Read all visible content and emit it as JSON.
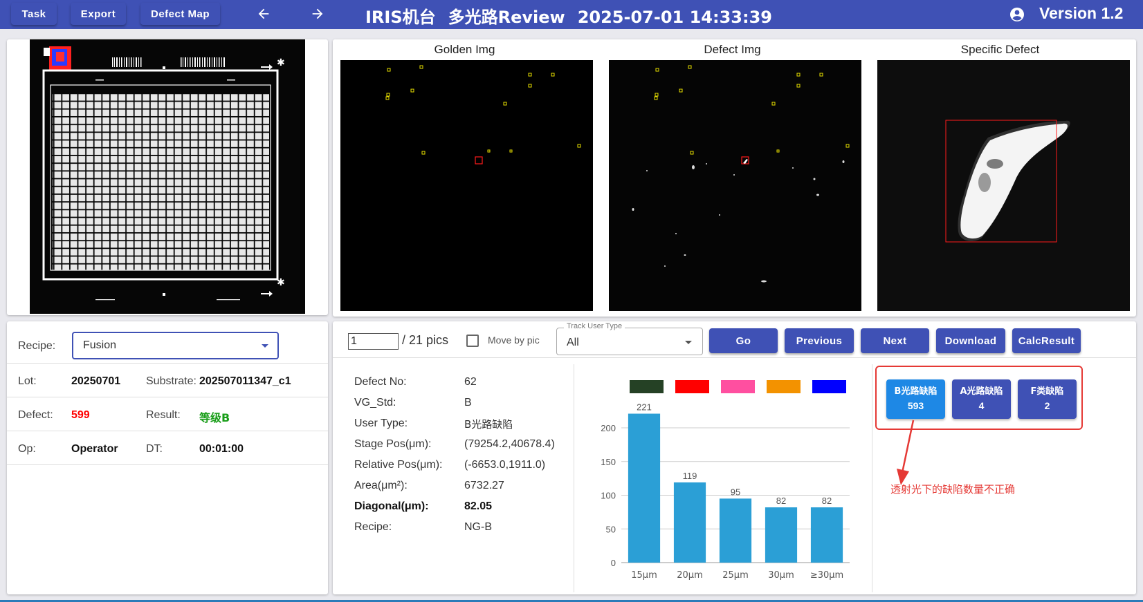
{
  "header": {
    "task_label": "Task",
    "export_label": "Export",
    "defect_map_label": "Defect Map",
    "back_icon": "arrow-left-icon",
    "forward_icon": "arrow-right-icon",
    "machine": "IRIS机台",
    "mode": "多光路Review",
    "datetime": "2025-07-01 14:33:39",
    "version": "Version 1.2",
    "account_icon": "account-circle-icon"
  },
  "images": {
    "golden_title": "Golden Img",
    "defect_title": "Defect Img",
    "specific_title": "Specific Defect"
  },
  "info": {
    "recipe_label": "Recipe:",
    "recipe_value": "Fusion",
    "lot_label": "Lot:",
    "lot_value": "20250701",
    "substrate_label": "Substrate:",
    "substrate_value": "202507011347_c1",
    "defect_label": "Defect:",
    "defect_value": "599",
    "result_label": "Result:",
    "result_value": "等级B",
    "op_label": "Op:",
    "op_value": "Operator",
    "dt_label": "DT:",
    "dt_value": "00:01:00"
  },
  "controls": {
    "page_value": "1",
    "pics_total": "/ 21 pics",
    "move_by_pic_label": "Move by pic",
    "move_by_pic_checked": false,
    "track_label": "Track User Type",
    "track_value": "All",
    "go_label": "Go",
    "previous_label": "Previous",
    "next_label": "Next",
    "download_label": "Download",
    "calc_label": "CalcResult"
  },
  "details": [
    {
      "label": "Defect No:",
      "value": "62"
    },
    {
      "label": "VG_Std:",
      "value": "B"
    },
    {
      "label": "User Type:",
      "value": "B光路缺陷"
    },
    {
      "label": "Stage Pos(μm):",
      "value": "(79254.2,40678.4)"
    },
    {
      "label": "Relative Pos(μm):",
      "value": "(-6653.0,1911.0)"
    },
    {
      "label": "Area(μm²):",
      "value": "6732.27"
    },
    {
      "label": "Diagonal(μm):",
      "value": "82.05"
    },
    {
      "label": "Recipe:",
      "value": "NG-B"
    }
  ],
  "legend_colors": [
    "#254125",
    "#ff0000",
    "#ff4fa0",
    "#f39200",
    "#0000ff"
  ],
  "chart_data": {
    "type": "bar",
    "categories": [
      "15μm",
      "20μm",
      "25μm",
      "30μm",
      "≥30μm"
    ],
    "values": [
      221,
      119,
      95,
      82,
      82
    ],
    "ylim": [
      0,
      240
    ],
    "yticks": [
      0,
      50,
      100,
      150,
      200
    ],
    "grid": true,
    "bar_color": "#2b9fd6"
  },
  "defect_types": [
    {
      "name": "B光路缺陷",
      "count": "593",
      "active": true
    },
    {
      "name": "A光路缺陷",
      "count": "4",
      "active": false
    },
    {
      "name": "F类缺陷",
      "count": "2",
      "active": false
    }
  ],
  "annotation": {
    "text": "透射光下的缺陷数量不正确"
  },
  "colors": {
    "primary": "#3f51b5",
    "active": "#1e88e5",
    "defect_count": "#ff0000",
    "result": "#1a9e1a",
    "annotation": "#e53935"
  }
}
